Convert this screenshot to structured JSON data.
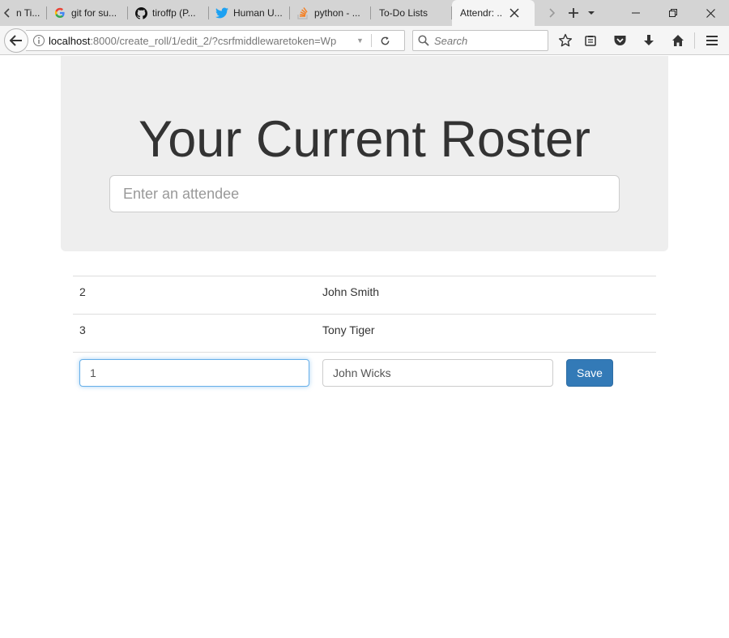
{
  "browser": {
    "tabs": [
      {
        "label": "n Ti..."
      },
      {
        "label": "git for su..."
      },
      {
        "label": "tiroffp (P..."
      },
      {
        "label": "Human U..."
      },
      {
        "label": "python - ..."
      },
      {
        "label": "To-Do Lists"
      },
      {
        "label": "Attendr: ..."
      }
    ],
    "url_host": "localhost",
    "url_rest": ":8000/create_roll/1/edit_2/?csrfmiddlewaretoken=Wp",
    "search_placeholder": "Search"
  },
  "page": {
    "title": "Your Current Roster",
    "attendee_placeholder": "Enter an attendee",
    "roster": [
      {
        "number": "2",
        "name": "John Smith"
      },
      {
        "number": "3",
        "name": "Tony Tiger"
      }
    ],
    "edit_row": {
      "number_value": "1",
      "name_value": "John Wicks",
      "save_label": "Save"
    }
  }
}
